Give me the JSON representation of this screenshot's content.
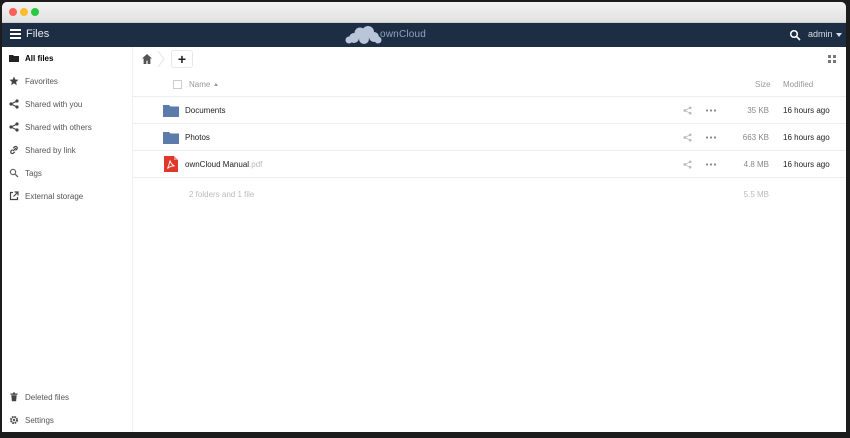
{
  "header": {
    "app_title": "Files",
    "logo_text": "ownCloud",
    "user": "admin",
    "bg_color": "#1d2d44"
  },
  "sidebar": {
    "items": [
      {
        "label": "All files",
        "icon": "folder-icon",
        "active": true
      },
      {
        "label": "Favorites",
        "icon": "star-icon"
      },
      {
        "label": "Shared with you",
        "icon": "share-icon"
      },
      {
        "label": "Shared with others",
        "icon": "share-icon"
      },
      {
        "label": "Shared by link",
        "icon": "link-icon"
      },
      {
        "label": "Tags",
        "icon": "tag-icon"
      },
      {
        "label": "External storage",
        "icon": "external-icon"
      }
    ],
    "bottom": {
      "deleted": "Deleted files",
      "settings": "Settings"
    }
  },
  "controls": {
    "new_label": "+"
  },
  "table": {
    "headers": {
      "name": "Name",
      "size": "Size",
      "modified": "Modified"
    },
    "rows": [
      {
        "name": "Documents",
        "ext": "",
        "type": "folder",
        "size": "35 KB",
        "modified": "16 hours ago"
      },
      {
        "name": "Photos",
        "ext": "",
        "type": "folder",
        "size": "663 KB",
        "modified": "16 hours ago"
      },
      {
        "name": "ownCloud Manual",
        "ext": ".pdf",
        "type": "pdf",
        "size": "4.8 MB",
        "modified": "16 hours ago"
      }
    ],
    "summary": {
      "text": "2 folders and 1 file",
      "size": "5.5 MB"
    }
  },
  "colors": {
    "folder": "#5b7bab",
    "pdf": "#e0392b"
  }
}
